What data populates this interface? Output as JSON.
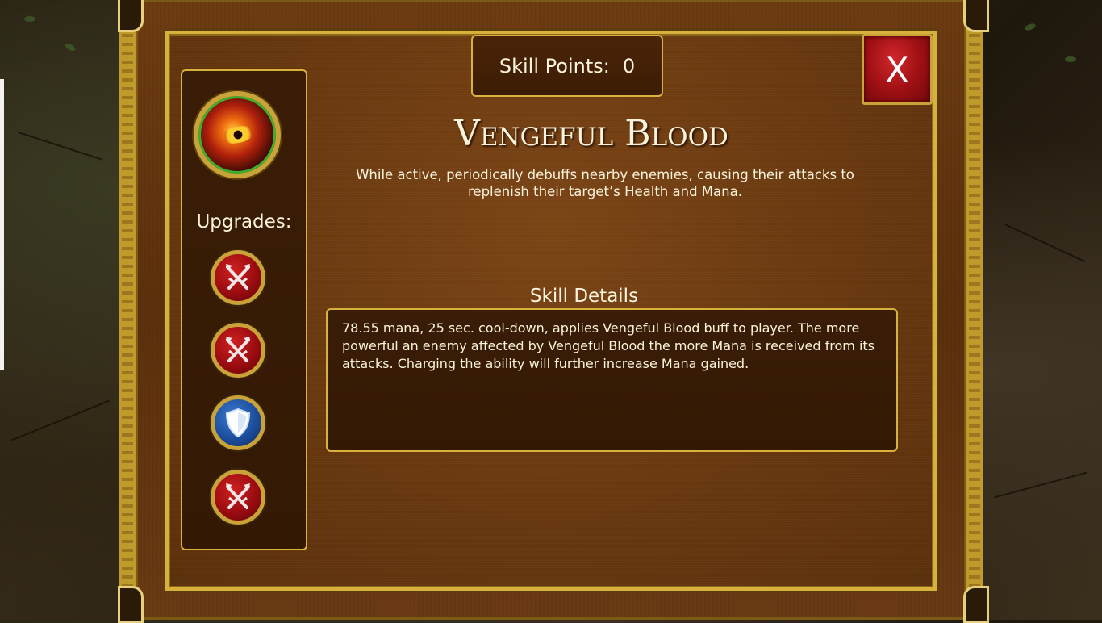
{
  "header": {
    "skill_points_label": "Skill Points:",
    "skill_points_value": "0",
    "close_label": "X"
  },
  "skill": {
    "name": "Vengeful Blood",
    "description": "While active, periodically debuffs nearby enemies, causing their attacks to replenish their target’s Health and Mana.",
    "icon": "dragon-eye-icon"
  },
  "sidebar": {
    "upgrades_title": "Upgrades:",
    "upgrades": [
      {
        "icon": "crossed-swords-icon",
        "color": "#a01014"
      },
      {
        "icon": "crossed-swords-icon",
        "color": "#a01014"
      },
      {
        "icon": "shield-icon",
        "color": "#1a4a98"
      },
      {
        "icon": "crossed-swords-icon",
        "color": "#a01014"
      }
    ]
  },
  "details": {
    "title": "Skill Details",
    "text": "78.55 mana, 25 sec. cool-down, applies Vengeful Blood buff to player. The more powerful an enemy affected by Vengeful Blood the more Mana is received from its attacks. Charging the ability will further increase Mana gained."
  },
  "colors": {
    "frame_gold": "#d7b13c",
    "panel_brown": "#68380f",
    "text_cream": "#fbf3dc",
    "close_red": "#a01014"
  }
}
